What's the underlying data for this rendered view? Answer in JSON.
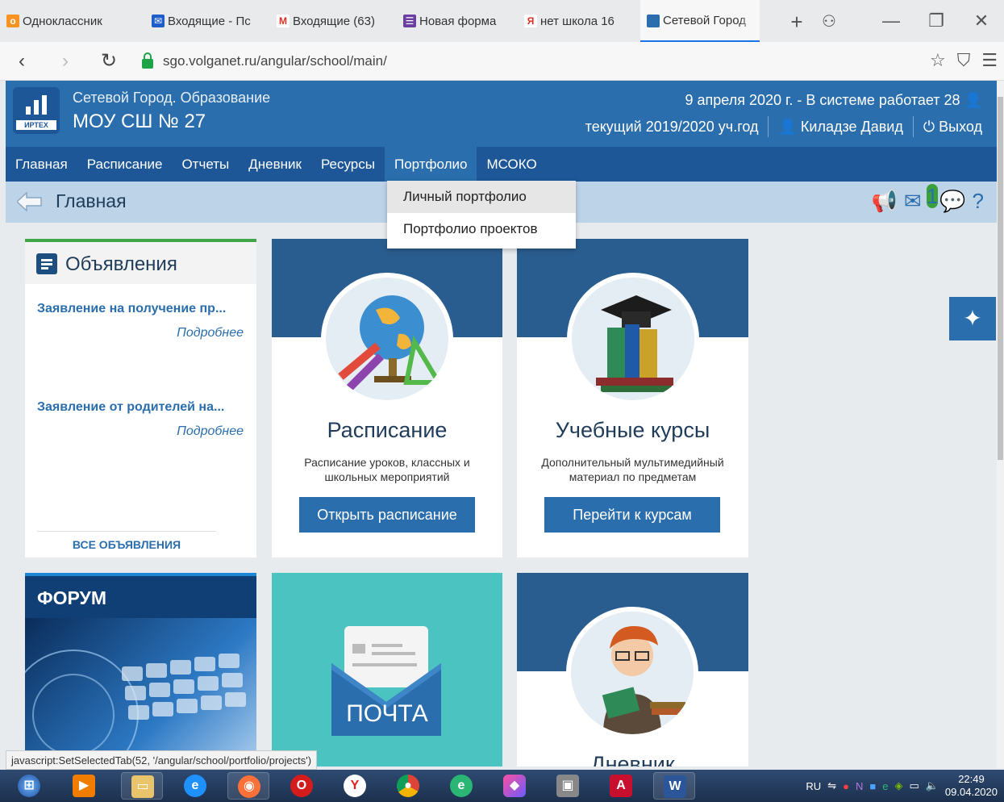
{
  "browser": {
    "tabs": [
      {
        "label": "Одноклассник",
        "fav_color": "#f7931e",
        "fav_glyph": "о",
        "active": false,
        "width": 180
      },
      {
        "label": "Входящие - Пс",
        "fav_color": "#1d5ec9",
        "fav_glyph": "✉",
        "active": false,
        "width": 155
      },
      {
        "label": "Входящие (63)",
        "fav_color": "#ffffff",
        "fav_glyph": "M",
        "active": false,
        "width": 157
      },
      {
        "label": "Новая форма",
        "fav_color": "#6a3fa0",
        "fav_glyph": "☰",
        "active": false,
        "width": 150
      },
      {
        "label": "нет школа 16",
        "fav_color": "#ffffff",
        "fav_glyph": "Я",
        "active": false,
        "width": 152
      },
      {
        "label": "Сетевой Город",
        "fav_color": "#2a6ead",
        "fav_glyph": "",
        "active": true,
        "width": 148
      }
    ],
    "url": "sgo.volganet.ru/angular/school/main/"
  },
  "header": {
    "org_small": "Сетевой Город. Образование",
    "org_big": "МОУ СШ № 27",
    "logo_text": "ИРТЕХ",
    "date_line": "9 апреля 2020 г. - В системе работает 28",
    "school_year": "текущий 2019/2020 уч.год",
    "user": "Киладзе Давид",
    "logout": "Выход"
  },
  "menu": [
    "Главная",
    "Расписание",
    "Отчеты",
    "Дневник",
    "Ресурсы",
    "Портфолио",
    "МСОКО"
  ],
  "dropdown": [
    "Личный портфолио",
    "Портфолио проектов"
  ],
  "breadcrumb": {
    "title": "Главная",
    "mail_badge": "1"
  },
  "news": {
    "title": "Объявления",
    "items": [
      {
        "title": "Заявление на получение пр...",
        "more": "Подробнее"
      },
      {
        "title": "Заявление от родителей на...",
        "more": "Подробнее"
      }
    ],
    "all": "ВСЕ ОБЪЯВЛЕНИЯ"
  },
  "cards": {
    "schedule": {
      "title": "Расписание",
      "desc": "Расписание уроков, классных и школьных мероприятий",
      "button": "Открыть расписание"
    },
    "courses": {
      "title": "Учебные курсы",
      "desc": "Дополнительный мультимедийный материал по предметам",
      "button": "Перейти к курсам"
    }
  },
  "forum": {
    "title": "ФОРУМ"
  },
  "mail": {
    "label": "ПОЧТА"
  },
  "diary": {
    "title": "Дневник"
  },
  "status_url": "javascript:SetSelectedTab(52, '/angular/school/portfolio/projects')",
  "taskbar": {
    "lang": "RU",
    "time": "22:49",
    "date": "09.04.2020"
  },
  "colors": {
    "primary": "#2a6ead",
    "menu": "#1d5798",
    "accent_green": "#3ea649",
    "mail_bg": "#4bc3c1"
  }
}
